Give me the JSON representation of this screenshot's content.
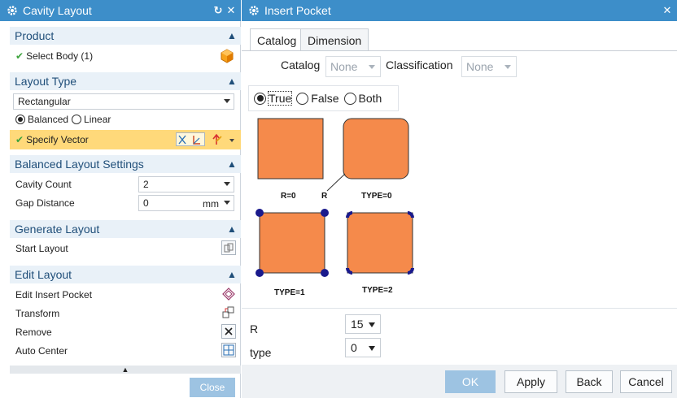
{
  "colors": {
    "title_bar": "#3d8ec9",
    "section_header_bg": "#e9f1f8",
    "section_header_text": "#1f4e79",
    "highlight_row": "#ffd97a",
    "pocket_fill": "#f58a4b",
    "corner_dot": "#1a1a8c",
    "check": "#3da33d",
    "button_primary": "#9dc3e2"
  },
  "cavity_layout": {
    "title": "Cavity Layout",
    "sections": {
      "product": {
        "title": "Product",
        "select_body": "Select Body (1)"
      },
      "layout_type": {
        "title": "Layout Type",
        "type_value": "Rectangular",
        "radio_balanced": "Balanced",
        "radio_linear": "Linear",
        "specify_vector": "Specify Vector"
      },
      "balanced_settings": {
        "title": "Balanced Layout Settings",
        "cavity_count_label": "Cavity Count",
        "cavity_count_value": "2",
        "gap_distance_label": "Gap Distance",
        "gap_distance_value": "0",
        "gap_unit": "mm"
      },
      "generate_layout": {
        "title": "Generate Layout",
        "start_layout": "Start Layout"
      },
      "edit_layout": {
        "title": "Edit Layout",
        "items": [
          "Edit Insert Pocket",
          "Transform",
          "Remove",
          "Auto Center"
        ]
      }
    },
    "close_label": "Close"
  },
  "insert_pocket": {
    "title": "Insert Pocket",
    "tabs": [
      "Catalog",
      "Dimension"
    ],
    "catalog_label": "Catalog",
    "catalog_value": "None",
    "classification_label": "Classification",
    "classification_value": "None",
    "radio_options": [
      "True",
      "False",
      "Both"
    ],
    "diagram_labels": {
      "r0": "R=0",
      "r": "R",
      "type0": "TYPE=0",
      "type1": "TYPE=1",
      "type2": "TYPE=2"
    },
    "params": {
      "r_label": "R",
      "r_value": "15",
      "type_label": "type",
      "type_value": "0"
    },
    "buttons": {
      "ok": "OK",
      "apply": "Apply",
      "back": "Back",
      "cancel": "Cancel"
    }
  }
}
